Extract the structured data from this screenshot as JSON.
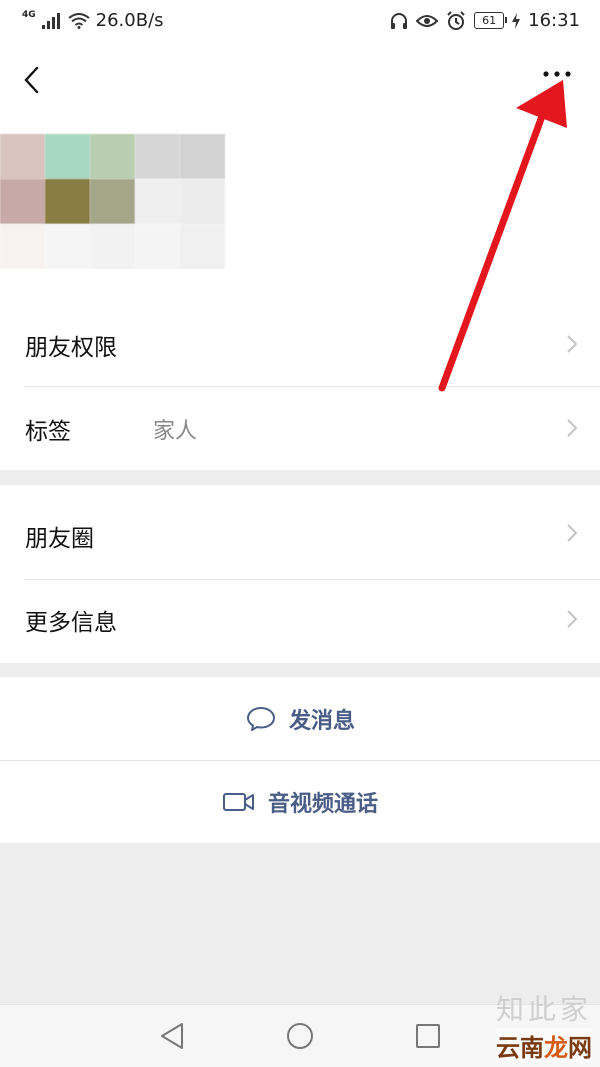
{
  "status_bar": {
    "network": "4G",
    "speed": "26.0B/s",
    "battery": "61",
    "time": "16:31"
  },
  "header": {
    "back_icon": "chevron-left-icon",
    "more_icon": "more-dots-icon"
  },
  "settings_group_1": [
    {
      "label": "朋友权限",
      "value": ""
    },
    {
      "label": "标签",
      "value": "家人"
    }
  ],
  "settings_group_2": [
    {
      "label": "朋友圈"
    },
    {
      "label": "更多信息"
    }
  ],
  "actions": {
    "send_message": {
      "label": "发消息",
      "icon": "chat-bubble-icon"
    },
    "av_call": {
      "label": "音视频通话",
      "icon": "video-camera-icon"
    }
  },
  "watermark": {
    "top": "知此家",
    "bottom_a": "云南",
    "bottom_b": "龙",
    "bottom_c": "网"
  },
  "colors": {
    "accent_text": "#4a5d87",
    "annotation_arrow": "#e3171d",
    "background": "#ededed"
  }
}
